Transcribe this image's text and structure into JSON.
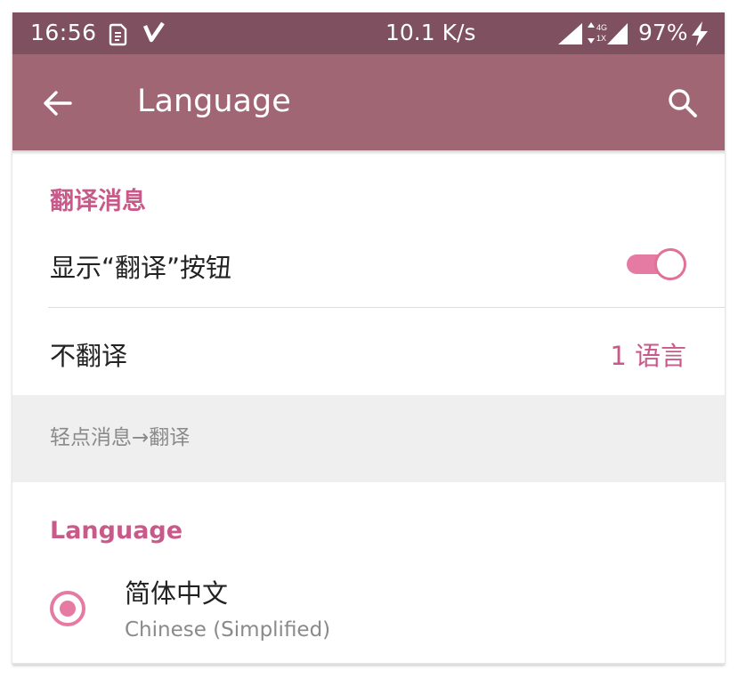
{
  "status_bar": {
    "time": "16:56",
    "network_speed": "10.1 K/s",
    "network_type_top": "4G",
    "network_type_bottom": "1X",
    "battery": "97%"
  },
  "app_bar": {
    "title": "Language"
  },
  "translate_section": {
    "header": "翻译消息",
    "show_button_label": "显示“翻译”按钮",
    "show_button_enabled": true,
    "do_not_translate_label": "不翻译",
    "do_not_translate_value": "1 语言",
    "hint": "轻点消息→翻译"
  },
  "language_section": {
    "header": "Language",
    "items": [
      {
        "name": "简体中文",
        "subtitle": "Chinese (Simplified)",
        "selected": true
      }
    ]
  },
  "colors": {
    "status_bar": "#7e5060",
    "app_bar": "#a06674",
    "accent": "#c85a8a",
    "toggle": "#e57aa3"
  }
}
